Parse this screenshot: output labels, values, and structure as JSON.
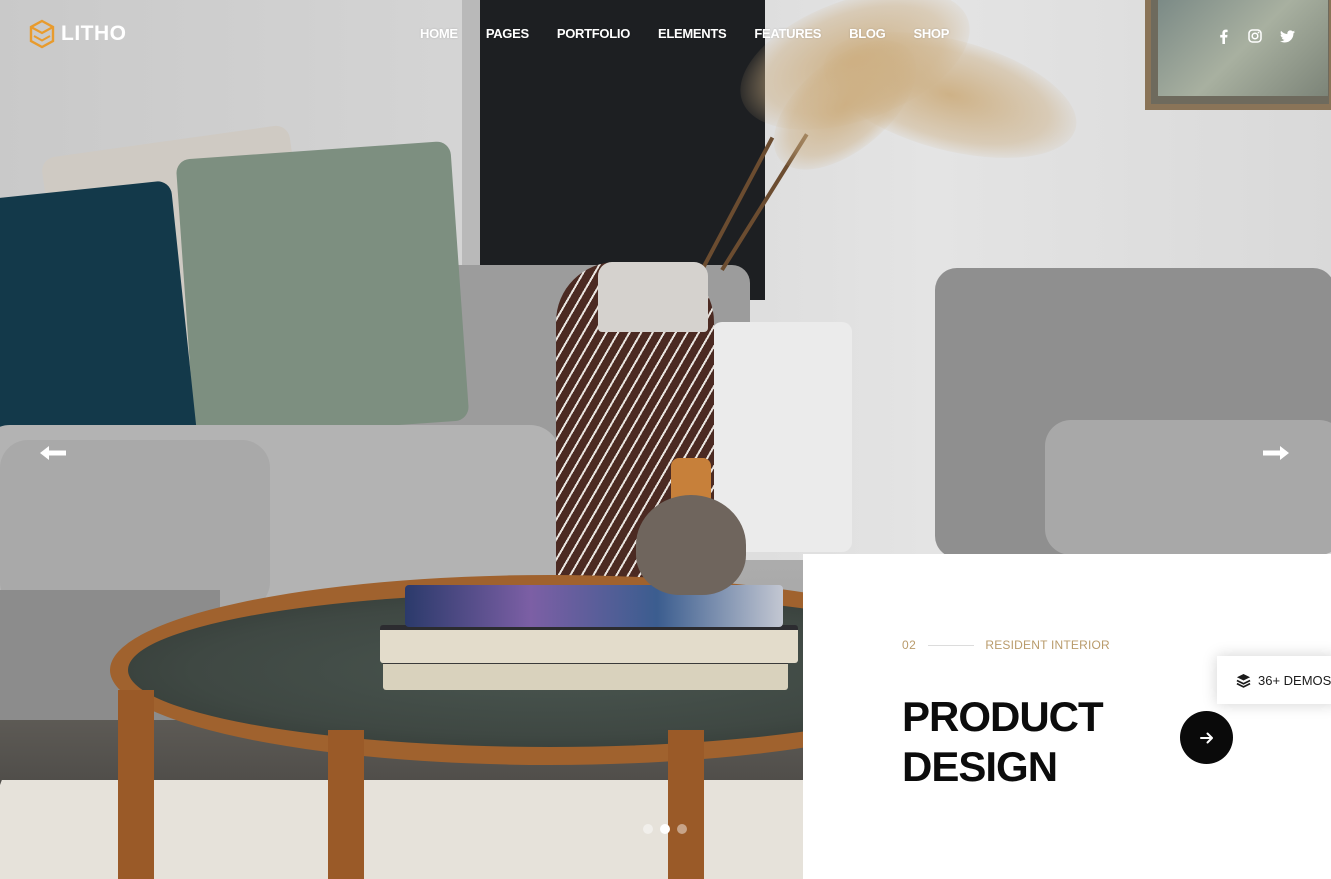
{
  "brand": {
    "name": "LITHO",
    "accent": "#e89b2d"
  },
  "nav": {
    "items": [
      {
        "label": "HOME"
      },
      {
        "label": "PAGES"
      },
      {
        "label": "PORTFOLIO"
      },
      {
        "label": "ELEMENTS"
      },
      {
        "label": "FEATURES"
      },
      {
        "label": "BLOG"
      },
      {
        "label": "SHOP"
      }
    ]
  },
  "social": [
    {
      "icon": "facebook-icon"
    },
    {
      "icon": "instagram-icon"
    },
    {
      "icon": "twitter-icon"
    }
  ],
  "slider": {
    "prev_icon": "arrow-left-icon",
    "next_icon": "arrow-right-icon",
    "slide_count": 3,
    "active_slide": 2,
    "caption": {
      "number": "02",
      "category": "RESIDENT INTERIOR",
      "title_line1": "PRODUCT",
      "title_line2": "DESIGN",
      "button_icon": "arrow-right-icon"
    }
  },
  "demos": {
    "label": "36+ DEMOS",
    "icon": "layers-icon"
  },
  "colors": {
    "caption_accent": "#b99b6b",
    "button_bg": "#0a0a0a"
  }
}
